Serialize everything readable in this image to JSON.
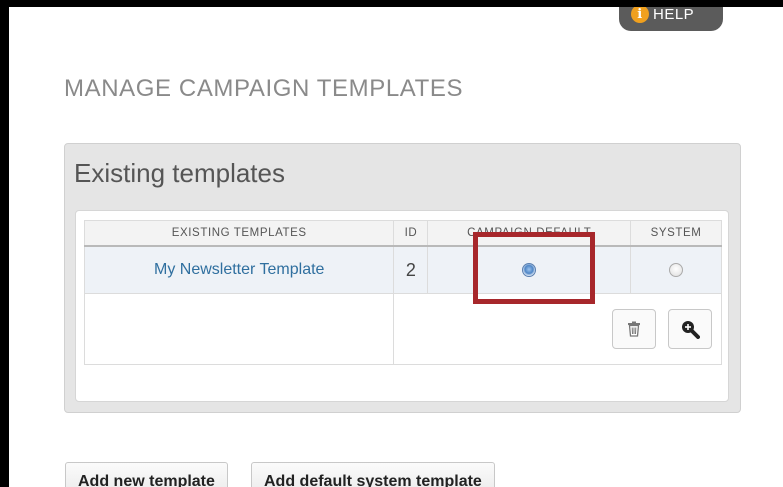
{
  "header": {
    "help_label": "HELP",
    "help_icon": "info-icon"
  },
  "page_title": "MANAGE CAMPAIGN TEMPLATES",
  "panel": {
    "title": "Existing templates",
    "table": {
      "columns": [
        "EXISTING TEMPLATES",
        "ID",
        "CAMPAIGN DEFAULT",
        "SYSTEM"
      ],
      "rows": [
        {
          "name": "My Newsletter Template",
          "id": "2",
          "campaign_default": true,
          "system": false
        }
      ],
      "actions": {
        "delete_icon": "trash-icon",
        "view_icon": "zoom-in-icon"
      }
    }
  },
  "highlight_color": "#a7272b",
  "footer_buttons": {
    "add_new": "Add new template",
    "add_default": "Add default system template"
  }
}
